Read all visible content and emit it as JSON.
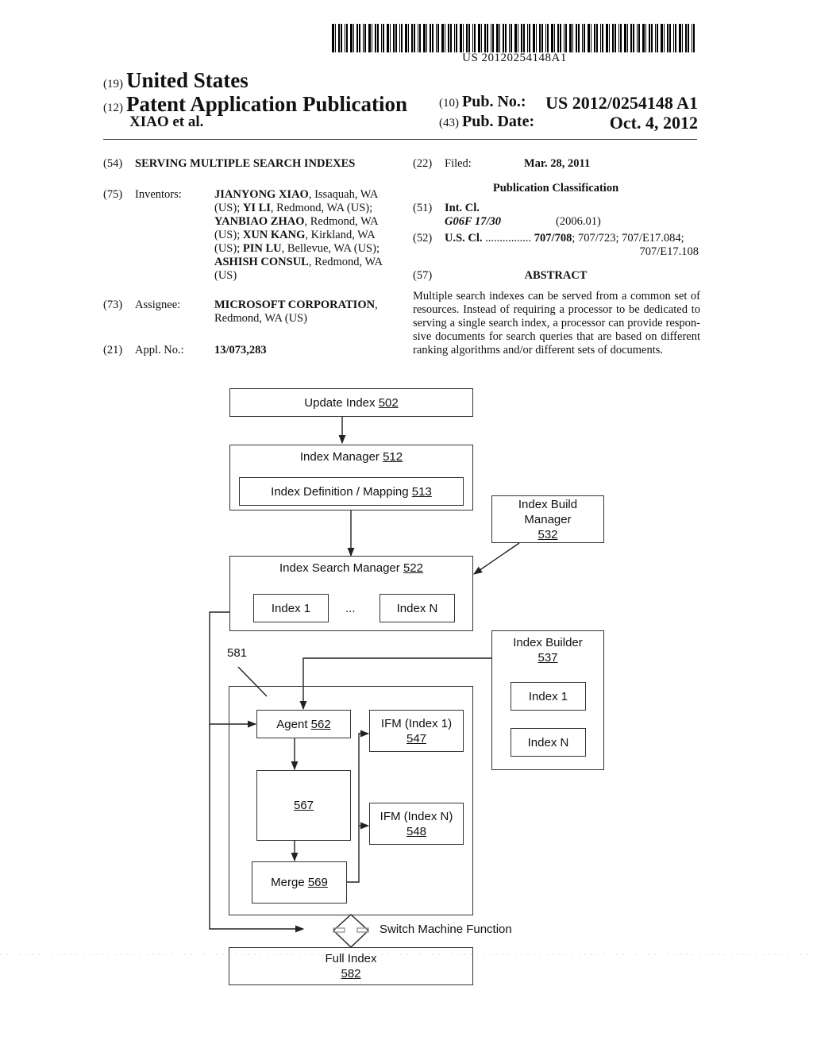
{
  "header": {
    "barcode_number": "US 20120254148A1",
    "country_code": "(19)",
    "country": "United States",
    "type_code": "(12)",
    "type": "Patent Application Publication",
    "authors": "XIAO et al.",
    "pub_no_code": "(10)",
    "pub_no_label": "Pub. No.:",
    "pub_no": "US 2012/0254148 A1",
    "pub_date_code": "(43)",
    "pub_date_label": "Pub. Date:",
    "pub_date": "Oct. 4, 2012"
  },
  "biblio": {
    "title_code": "(54)",
    "title": "SERVING MULTIPLE SEARCH INDEXES",
    "inventors_code": "(75)",
    "inventors_label": "Inventors:",
    "inventors_lines": [
      [
        {
          "t": "JIANYONG XIAO",
          "b": true
        },
        {
          "t": ", Issaquah, WA",
          "b": false
        }
      ],
      [
        {
          "t": "(US); ",
          "b": false
        },
        {
          "t": "YI LI",
          "b": true
        },
        {
          "t": ", Redmond, WA (US);",
          "b": false
        }
      ],
      [
        {
          "t": "YANBIAO ZHAO",
          "b": true
        },
        {
          "t": ", Redmond, WA",
          "b": false
        }
      ],
      [
        {
          "t": "(US); ",
          "b": false
        },
        {
          "t": "XUN KANG",
          "b": true
        },
        {
          "t": ", Kirkland, WA",
          "b": false
        }
      ],
      [
        {
          "t": "(US); ",
          "b": false
        },
        {
          "t": "PIN LU",
          "b": true
        },
        {
          "t": ", Bellevue, WA (US);",
          "b": false
        }
      ],
      [
        {
          "t": "ASHISH CONSUL",
          "b": true
        },
        {
          "t": ", Redmond, WA",
          "b": false
        }
      ],
      [
        {
          "t": "(US)",
          "b": false
        }
      ]
    ],
    "assignee_code": "(73)",
    "assignee_label": "Assignee:",
    "assignee_name": "MICROSOFT CORPORATION",
    "assignee_location": "Redmond, WA (US)",
    "appl_code": "(21)",
    "appl_label": "Appl. No.:",
    "appl_no": "13/073,283",
    "filed_code": "(22)",
    "filed_label": "Filed:",
    "filed_date": "Mar. 28, 2011",
    "pub_class_heading": "Publication Classification",
    "intcl_code": "(51)",
    "intcl_label": "Int. Cl.",
    "intcl_class": "G06F 17/30",
    "intcl_year": "(2006.01)",
    "uscl_code": "(52)",
    "uscl_label": "U.S. Cl.",
    "uscl_dots": "................",
    "uscl_primary": "707/708",
    "uscl_rest": "; 707/723; 707/E17.084;",
    "uscl_line2": "707/E17.108",
    "abstract_code": "(57)",
    "abstract_heading": "ABSTRACT",
    "abstract_lines": [
      "Multiple search indexes can be served from a common set of",
      "resources. Instead of requiring a processor to be dedicated to",
      "serving a single search index, a processor can provide respon-",
      "sive documents for search queries that are based on different",
      "ranking algorithms and/or different sets of documents."
    ]
  },
  "diagram": {
    "update_index": {
      "label": "Update Index ",
      "ref": "502"
    },
    "index_manager": {
      "label": "Index Manager ",
      "ref": "512"
    },
    "index_definition": {
      "label": "Index Definition / Mapping ",
      "ref": "513"
    },
    "index_build_manager": {
      "line1": "Index Build",
      "line2": "Manager",
      "ref": "532"
    },
    "index_search_manager": {
      "label": "Index Search Manager ",
      "ref": "522"
    },
    "ism_index1": "Index 1",
    "ism_ellipsis": "...",
    "ism_indexN": "Index N",
    "index_builder": {
      "label": "Index Builder",
      "ref": "537"
    },
    "ib_index1": "Index 1",
    "ib_indexN": "Index N",
    "group_ref": "581",
    "agent": {
      "label": "Agent ",
      "ref": "562"
    },
    "box567": {
      "ref": "567"
    },
    "merge": {
      "label": "Merge ",
      "ref": "569"
    },
    "ifm1": {
      "label": "IFM (Index 1)",
      "ref": "547"
    },
    "ifmN": {
      "label": "IFM (Index N)",
      "ref": "548"
    },
    "switch_label": "Switch Machine Function",
    "full_index": {
      "label": "Full Index",
      "ref": "582"
    }
  }
}
